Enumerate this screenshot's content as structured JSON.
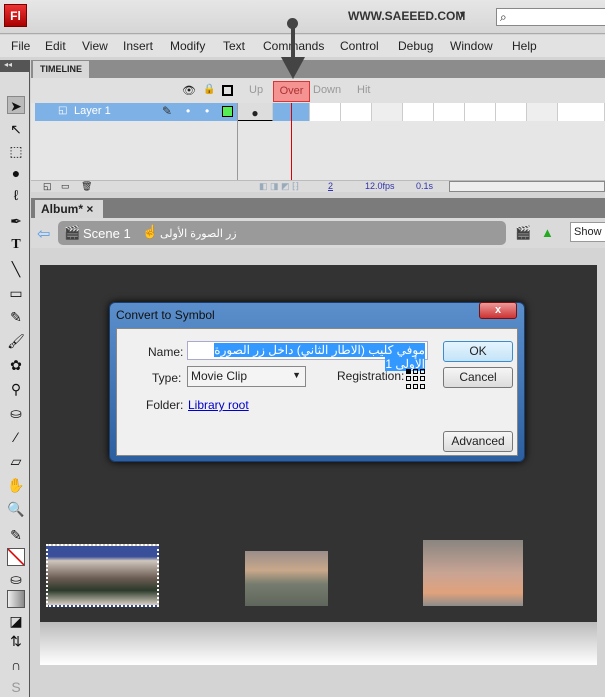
{
  "app": {
    "logo": "Fl",
    "site": "WWW.SAEEED.COM",
    "search_icon": "magnifier-icon"
  },
  "menu": [
    "File",
    "Edit",
    "View",
    "Insert",
    "Modify",
    "Text",
    "Commands",
    "Control",
    "Debug",
    "Window",
    "Help"
  ],
  "timeline": {
    "tab": "TIMELINE",
    "frame_labels": [
      "Up",
      "Over",
      "Down",
      "Hit"
    ],
    "layer": "Layer 1",
    "current_frame": "2",
    "fps": "12.0fps",
    "time": "0.1s",
    "highlight_color": "#f59292"
  },
  "document": {
    "tab": "Album*",
    "close": "×",
    "scene": "Scene 1",
    "breadcrumb": "زر الصورة الأولى",
    "show": "Show"
  },
  "dialog": {
    "title": "Convert to Symbol",
    "close": "x",
    "name_label": "Name:",
    "name_value": "موفي كليب (الاطار الثاني) داخل زر الصورة الأولى 1",
    "type_label": "Type:",
    "type_value": "Movie Clip",
    "registration_label": "Registration:",
    "folder_label": "Folder:",
    "folder_value": "Library root",
    "ok": "OK",
    "cancel": "Cancel",
    "advanced": "Advanced"
  }
}
